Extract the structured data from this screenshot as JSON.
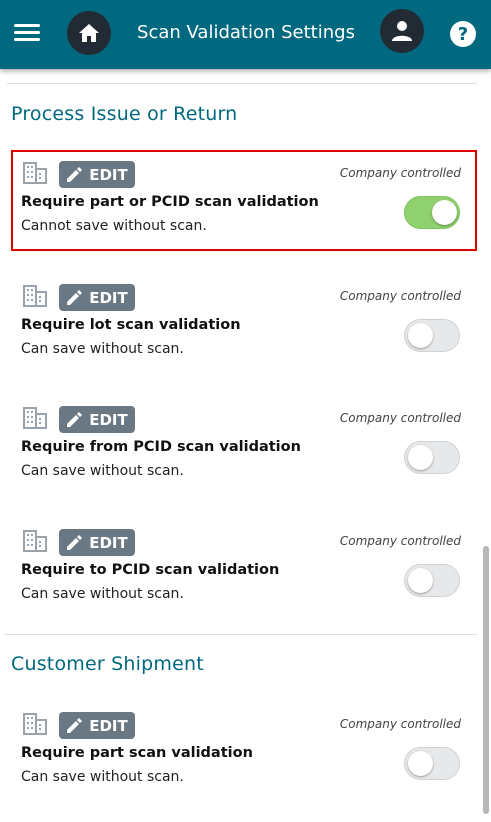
{
  "header": {
    "title": "Scan Validation Settings",
    "help_label": "?"
  },
  "sections": [
    {
      "title": "Process Issue or Return",
      "settings": [
        {
          "edit_label": "EDIT",
          "controlled_label": "Company controlled",
          "name": "Require part or PCID scan validation",
          "description": "Cannot save without scan.",
          "enabled": true,
          "highlighted": true
        },
        {
          "edit_label": "EDIT",
          "controlled_label": "Company controlled",
          "name": "Require lot scan validation",
          "description": "Can save without scan.",
          "enabled": false
        },
        {
          "edit_label": "EDIT",
          "controlled_label": "Company controlled",
          "name": "Require from PCID scan validation",
          "description": "Can save without scan.",
          "enabled": false
        },
        {
          "edit_label": "EDIT",
          "controlled_label": "Company controlled",
          "name": "Require to PCID scan validation",
          "description": "Can save without scan.",
          "enabled": false
        }
      ]
    },
    {
      "title": "Customer Shipment",
      "settings": [
        {
          "edit_label": "EDIT",
          "controlled_label": "Company controlled",
          "name": "Require part scan validation",
          "description": "Can save without scan.",
          "enabled": false
        }
      ]
    }
  ],
  "colors": {
    "appbar": "#00697f",
    "accent_text": "#00697f",
    "toggle_on": "#8fd16e",
    "edit_button": "#6a7884",
    "highlight_border": "#e00000"
  },
  "icons": {
    "menu": "hamburger-icon",
    "home": "home-icon",
    "user": "user-icon",
    "help": "help-icon",
    "building": "building-icon",
    "edit": "pencil-icon"
  }
}
